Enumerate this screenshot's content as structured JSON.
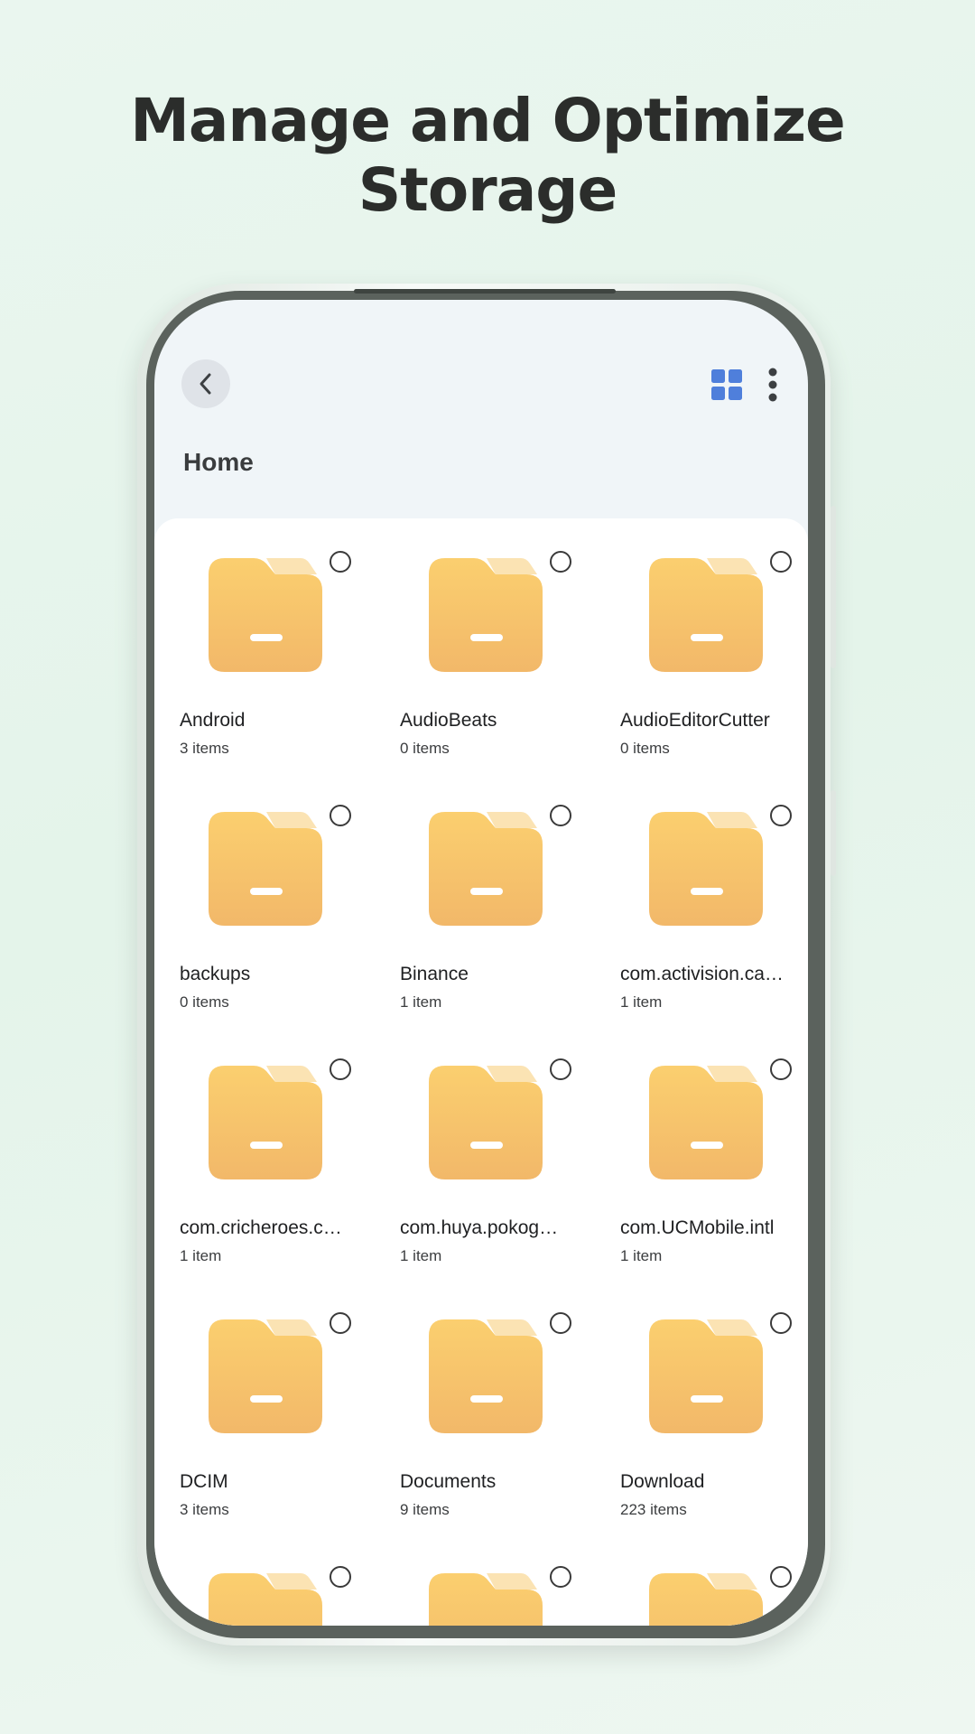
{
  "headline": "Manage and Optimize Storage",
  "topbar": {
    "back_icon": "chevron-left-icon",
    "view_icon": "grid-view-icon",
    "more_icon": "more-vertical-icon",
    "accent_color": "#4f7fdb"
  },
  "page_title": "Home",
  "folder_color": "#f7c067",
  "folders": [
    {
      "name": "Android",
      "count": "3 items"
    },
    {
      "name": "AudioBeats",
      "count": "0 items"
    },
    {
      "name": "AudioEditorCutter",
      "count": "0 items"
    },
    {
      "name": "backups",
      "count": "0 items"
    },
    {
      "name": "Binance",
      "count": "1 item"
    },
    {
      "name": "com.activision.ca…",
      "count": "1 item"
    },
    {
      "name": "com.cricheroes.c…",
      "count": "1 item"
    },
    {
      "name": "com.huya.pokog…",
      "count": "1 item"
    },
    {
      "name": "com.UCMobile.intl",
      "count": "1 item"
    },
    {
      "name": "DCIM",
      "count": "3 items"
    },
    {
      "name": "Documents",
      "count": "9 items"
    },
    {
      "name": "Download",
      "count": "223 items"
    },
    {
      "name": "",
      "count": ""
    },
    {
      "name": "",
      "count": ""
    },
    {
      "name": "",
      "count": ""
    }
  ]
}
